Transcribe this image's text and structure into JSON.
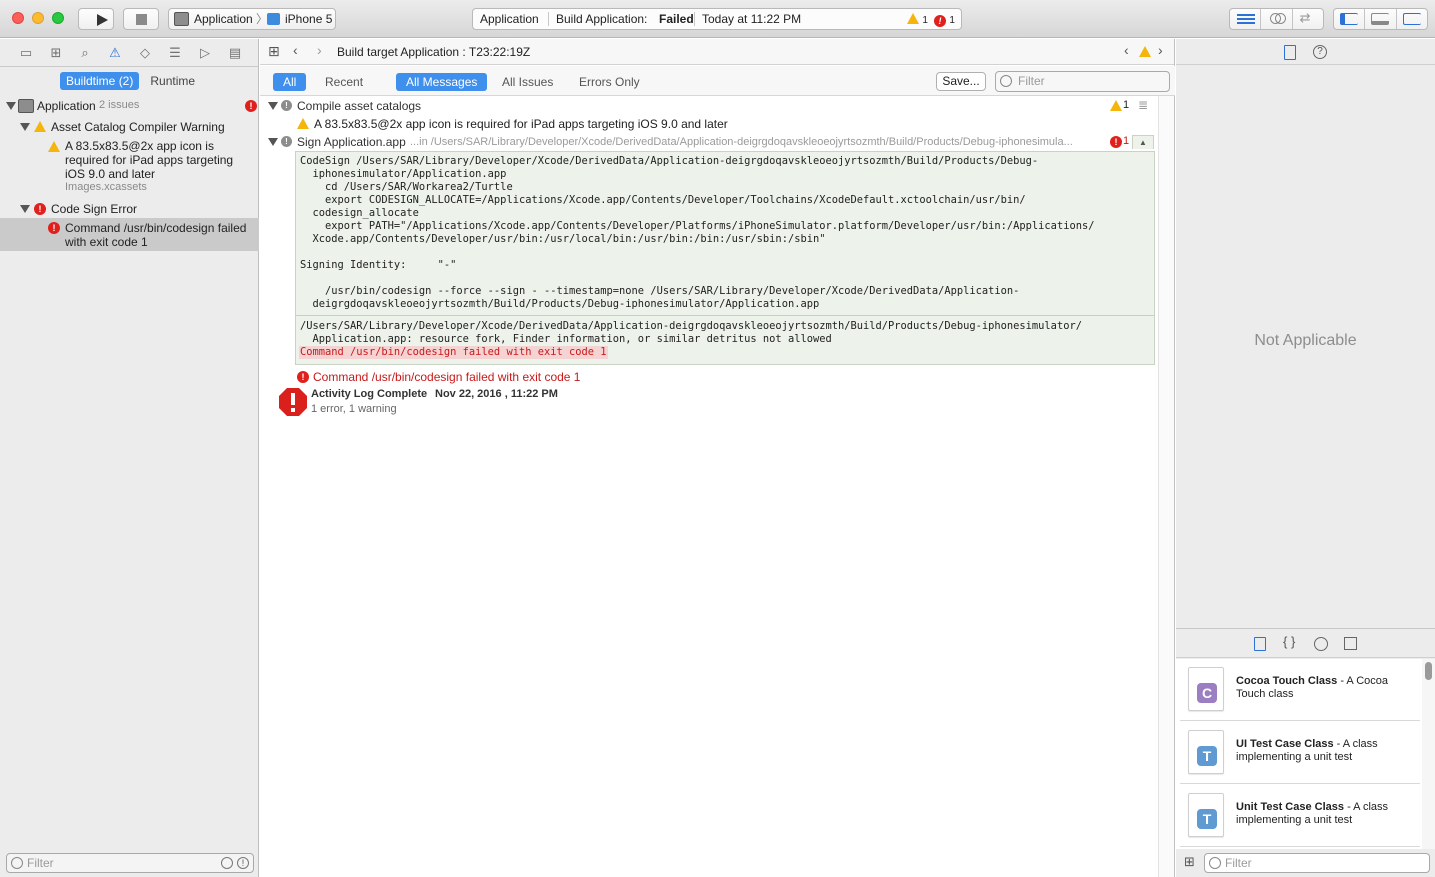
{
  "toolbar": {
    "scheme_app": "Application",
    "scheme_device": "iPhone 5",
    "activity_project": "Application",
    "activity_task": "Build Application:",
    "activity_status": "Failed",
    "activity_time": "Today at 11:22 PM",
    "warning_count": "1",
    "error_count": "1"
  },
  "navigator": {
    "tabs": [
      "Buildtime (2)",
      "Runtime"
    ],
    "active_tab": "Buildtime (2)",
    "root_label": "Application",
    "root_issues": "2 issues",
    "group_warning_label": "Asset Catalog Compiler Warning",
    "warning_item_text": "A 83.5x83.5@2x app icon is required for iPad apps targeting iOS 9.0 and later",
    "warning_item_file": "Images.xcassets",
    "group_error_label": "Code Sign Error",
    "error_item_text": "Command /usr/bin/codesign failed with exit code 1",
    "filter_placeholder": "Filter"
  },
  "editor": {
    "jump_bar_title": "Build target Application : T23:22:19Z",
    "scope_left": [
      "All",
      "Recent"
    ],
    "scope_right": [
      "All Messages",
      "All Issues",
      "Errors Only"
    ],
    "save_label": "Save...",
    "filter_placeholder": "Filter",
    "step1_title": "Compile asset catalogs",
    "step1_warning_count": "1",
    "step1_warning_text": "A 83.5x83.5@2x app icon is required for iPad apps targeting iOS 9.0 and later",
    "step2_title": "Sign Application.app",
    "step2_path": "...in /Users/SAR/Library/Developer/Xcode/DerivedData/Application-deigrgdoqavskleoeojyrtsozmth/Build/Products/Debug-iphonesimula...",
    "step2_error_count": "1",
    "code_block_1": "CodeSign /Users/SAR/Library/Developer/Xcode/DerivedData/Application-deigrgdoqavskleoeojyrtsozmth/Build/Products/Debug-\n  iphonesimulator/Application.app\n    cd /Users/SAR/Workarea2/Turtle\n    export CODESIGN_ALLOCATE=/Applications/Xcode.app/Contents/Developer/Toolchains/XcodeDefault.xctoolchain/usr/bin/\n  codesign_allocate\n    export PATH=\"/Applications/Xcode.app/Contents/Developer/Platforms/iPhoneSimulator.platform/Developer/usr/bin:/Applications/\n  Xcode.app/Contents/Developer/usr/bin:/usr/local/bin:/usr/bin:/bin:/usr/sbin:/sbin\"\n\nSigning Identity:     \"-\"\n\n    /usr/bin/codesign --force --sign - --timestamp=none /Users/SAR/Library/Developer/Xcode/DerivedData/Application-\n  deigrgdoqavskleoeojyrtsozmth/Build/Products/Debug-iphonesimulator/Application.app",
    "code_block_2": "/Users/SAR/Library/Developer/Xcode/DerivedData/Application-deigrgdoqavskleoeojyrtsozmth/Build/Products/Debug-iphonesimulator/\n  Application.app: resource fork, Finder information, or similar detritus not allowed",
    "code_error_line": "Command /usr/bin/codesign failed with exit code 1",
    "summary_error_text": "Command /usr/bin/codesign failed with exit code 1",
    "activity_log_title": "Activity Log Complete",
    "activity_log_date": "Nov 22, 2016 , 11:22 PM",
    "activity_log_summary": "1 error, 1 warning"
  },
  "inspector": {
    "not_applicable": "Not Applicable",
    "library_items": [
      {
        "badge": "C",
        "color": "#9b7fc2",
        "title": "Cocoa Touch Class",
        "desc": " - A Cocoa Touch class"
      },
      {
        "badge": "T",
        "color": "#5f9ad3",
        "title": "UI Test Case Class",
        "desc": " - A class implementing a unit test"
      },
      {
        "badge": "T",
        "color": "#5f9ad3",
        "title": "Unit Test Case Class",
        "desc": " - A class implementing a unit test"
      }
    ],
    "filter_placeholder": "Filter"
  }
}
